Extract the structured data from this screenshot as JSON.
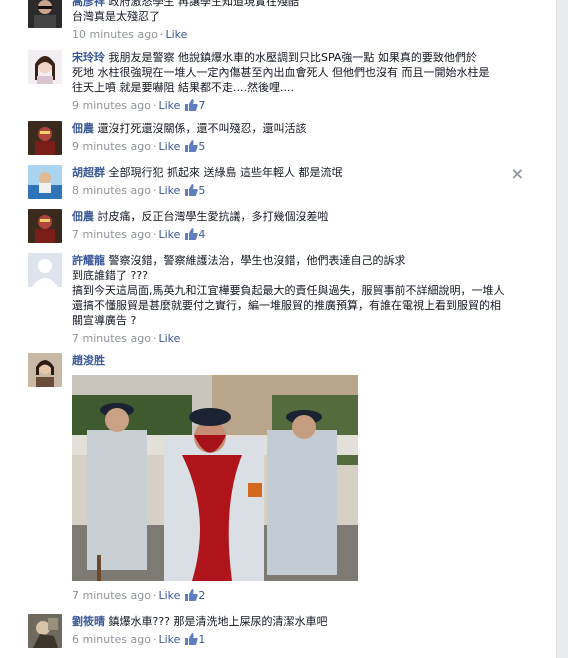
{
  "comments": [
    {
      "author": "高彥祥",
      "lines": [
        "政府激怒學生 再讓學生知道現實在殘酷",
        "台灣真是太殘忍了"
      ],
      "time": "10 minutes ago",
      "like_label": "Like",
      "like_count": ""
    },
    {
      "author": "宋玲玲",
      "lines": [
        "我朋友是警察 他說鎮爆水車的水壓調到只比SPA強一點 如果真的要致他們於",
        "死地 水柱很強現在一堆人一定內傷甚至內出血會死人 但他們也沒有 而且一開始水柱是",
        "往天上噴 就是要嚇阻 結果都不走....然後哩...."
      ],
      "time": "9 minutes ago",
      "like_label": "Like",
      "like_count": "7"
    },
    {
      "author": "佃農",
      "lines": [
        "還沒打死還沒關係，還不叫殘忍，還叫活該"
      ],
      "time": "9 minutes ago",
      "like_label": "Like",
      "like_count": "5"
    },
    {
      "author": "胡超群",
      "lines": [
        "全部現行犯 抓起來 送綠島 這些年輕人 都是流氓"
      ],
      "time": "8 minutes ago",
      "like_label": "Like",
      "like_count": "5",
      "close_glyph": "×"
    },
    {
      "author": "佃農",
      "lines": [
        "討皮痛，反正台灣學生愛抗議，多打幾個沒差啦"
      ],
      "time": "7 minutes ago",
      "like_label": "Like",
      "like_count": "4"
    },
    {
      "author": "許耀龍",
      "lines": [
        "警察沒錯，警察維護法治，學生也沒錯，他們表達自己的訴求",
        "到底誰錯了 ???",
        "搞到今天這局面,馬英九和江宜樺要負起最大的責任與過失，服貿事前不詳細說明，一堆人",
        "還搞不懂服貿是甚麼就要付之實行，編一堆服貿的推廣預算，有誰在電視上看到服貿的相",
        "關宣導廣告 ?"
      ],
      "time": "7 minutes ago",
      "like_label": "Like",
      "like_count": ""
    },
    {
      "author": "趙浚胜",
      "lines": [],
      "time": "7 minutes ago",
      "like_label": "Like",
      "like_count": "2"
    },
    {
      "author": "劉筱晴",
      "lines": [
        "鎮爆水車??? 那是清洗地上屎尿的清潔水車吧"
      ],
      "time": "6 minutes ago",
      "like_label": "Like",
      "like_count": "1"
    }
  ],
  "separator": "·",
  "colors": {
    "author": "#3b5998",
    "meta": "#90949c",
    "text": "#141823",
    "thumb": "#5f7ec1"
  }
}
